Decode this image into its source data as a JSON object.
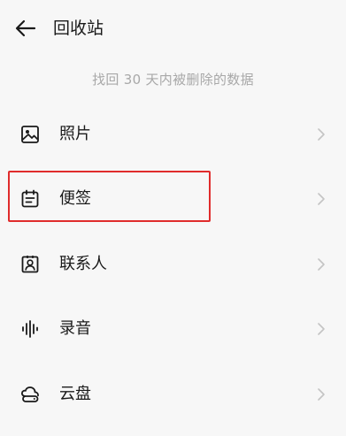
{
  "header": {
    "title": "回收站",
    "back_icon": "arrow-left-icon"
  },
  "hint": "找回 30 天内被删除的数据",
  "items": [
    {
      "label": "照片",
      "icon": "image-icon"
    },
    {
      "label": "便签",
      "icon": "notes-icon"
    },
    {
      "label": "联系人",
      "icon": "contact-icon"
    },
    {
      "label": "录音",
      "icon": "waveform-icon"
    },
    {
      "label": "云盘",
      "icon": "cloud-drive-icon"
    }
  ],
  "colors": {
    "background": "#f7f7f7",
    "text": "#1a1a1a",
    "hint": "#a8a8a8",
    "chevron": "#c4c4c4",
    "highlight_border": "#e02c2c"
  }
}
